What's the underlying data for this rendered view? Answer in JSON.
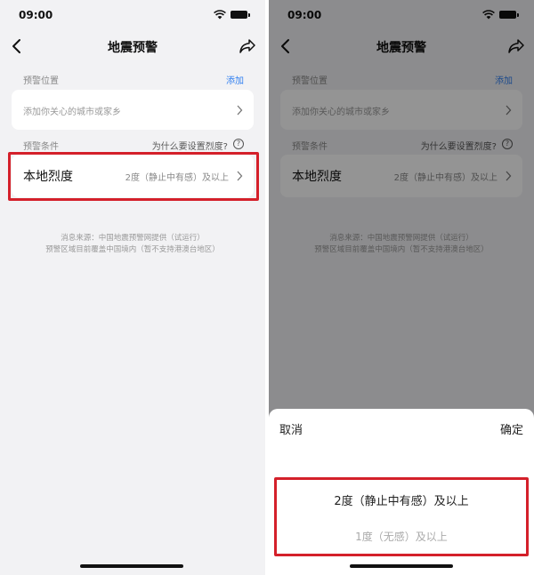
{
  "status": {
    "time": "09:00"
  },
  "nav": {
    "title": "地震预警"
  },
  "location_section": {
    "label": "预警位置",
    "add_label": "添加"
  },
  "location_card": {
    "placeholder": "添加你关心的城市或家乡"
  },
  "condition_section": {
    "label": "预警条件",
    "why_label": "为什么要设置烈度?",
    "help_glyph": "?"
  },
  "intensity_row": {
    "title": "本地烈度",
    "value": "2度（静止中有感）及以上"
  },
  "footer": {
    "line1": "消息来源：中国地震预警网提供（试运行）",
    "line2": "预警区域目前覆盖中国境内（暂不支持港澳台地区）"
  },
  "picker": {
    "cancel_label": "取消",
    "confirm_label": "确定",
    "options": [
      {
        "label": "2度（静止中有感）及以上"
      },
      {
        "label": "1度（无感）及以上"
      }
    ]
  },
  "colors": {
    "accent": "#2f7ff0",
    "highlight": "#d4202a",
    "background": "#f2f2f4"
  }
}
